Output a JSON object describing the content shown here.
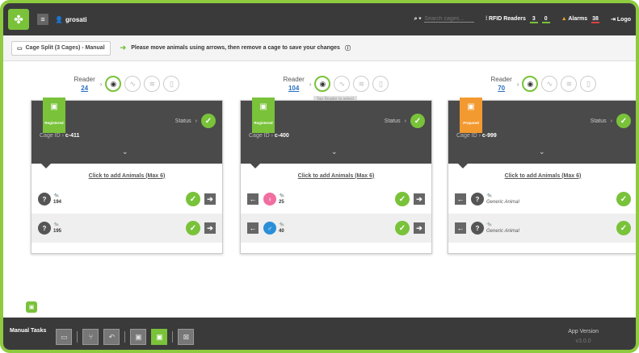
{
  "topbar": {
    "user": "grosati",
    "search_placeholder": "Search cages...",
    "rfid_label": "RFID Readers",
    "rfid_count_a": "3",
    "rfid_count_b": "0",
    "alarms_label": "Alarms",
    "alarms_count": "38",
    "logout_label": "Logo"
  },
  "header": {
    "tab_label": "Cage Split (3 Cages) - Manual",
    "instruction": "Please move animals using arrows, then remove a cage to save your changes"
  },
  "columns": [
    {
      "reader_label": "Reader",
      "reader_num": "24",
      "badge": "Registered",
      "status_label": "Status",
      "cage_id_label": "Cage ID",
      "cage_id": "c-411",
      "add_link": "Click to add Animals (Max 6)",
      "animals": [
        {
          "name": "194",
          "sex": "?"
        },
        {
          "name": "195",
          "sex": "?"
        }
      ]
    },
    {
      "reader_label": "Reader",
      "reader_num": "104",
      "tooltip": "Tap Reader to select",
      "badge": "Registered",
      "status_label": "Status",
      "cage_id_label": "Cage ID",
      "cage_id": "c-400",
      "add_link": "Click to add Animals (Max 6)",
      "animals": [
        {
          "name": "25",
          "sex": "♀"
        },
        {
          "name": "40",
          "sex": "♂"
        }
      ]
    },
    {
      "reader_label": "Reader",
      "reader_num": "70",
      "badge": "Prepared",
      "status_label": "Status",
      "cage_id_label": "Cage ID",
      "cage_id": "c-999",
      "add_link": "Click to add Animals (Max 6)",
      "animals": [
        {
          "name": "Generic Animal",
          "sex": "?"
        },
        {
          "name": "Generic Animal",
          "sex": "?"
        }
      ]
    }
  ],
  "bottombar": {
    "manual_tasks_label": "Manual Tasks",
    "app_version_label": "App Version",
    "app_version": "v3.0.0"
  },
  "colors": {
    "accent": "#79c23a",
    "prepared": "#f29a30",
    "dark": "#3a3a3a"
  }
}
